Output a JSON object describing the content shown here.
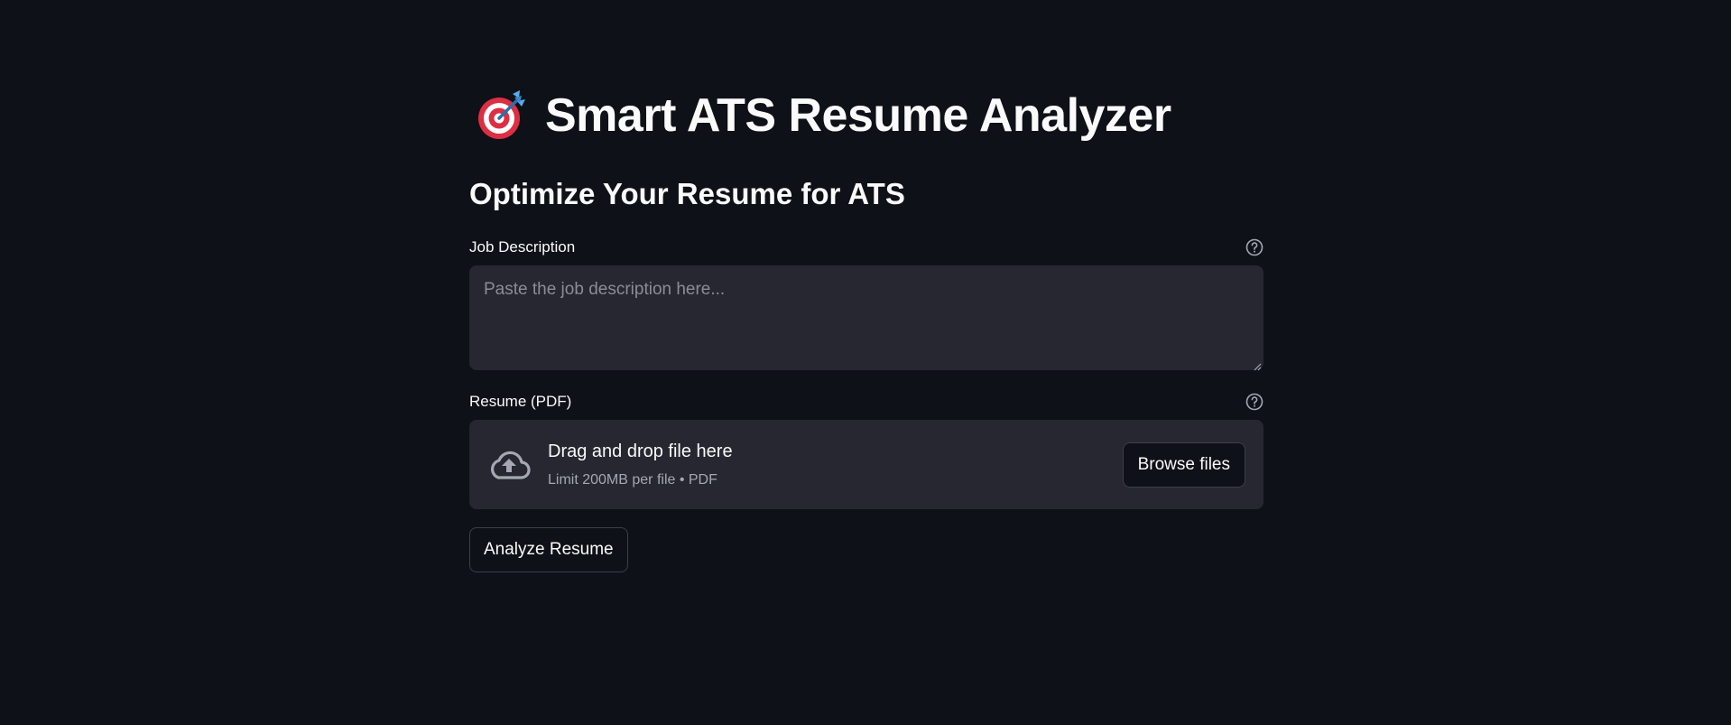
{
  "header": {
    "icon": "target-dart-icon",
    "title": "Smart ATS Resume Analyzer"
  },
  "subtitle": "Optimize Your Resume for ATS",
  "job_description": {
    "label": "Job Description",
    "value": "",
    "placeholder": "Paste the job description here...",
    "help_icon": "help-circle-icon"
  },
  "resume": {
    "label": "Resume (PDF)",
    "help_icon": "help-circle-icon",
    "uploader": {
      "icon": "cloud-upload-icon",
      "title": "Drag and drop file here",
      "limit": "Limit 200MB per file • PDF",
      "browse_label": "Browse files"
    }
  },
  "actions": {
    "analyze_label": "Analyze Resume"
  },
  "colors": {
    "background": "#0e1117",
    "input_background": "#262730",
    "text": "#fafafa",
    "muted_text": "#a3a8b4",
    "button_border": "#3d3f4a"
  }
}
